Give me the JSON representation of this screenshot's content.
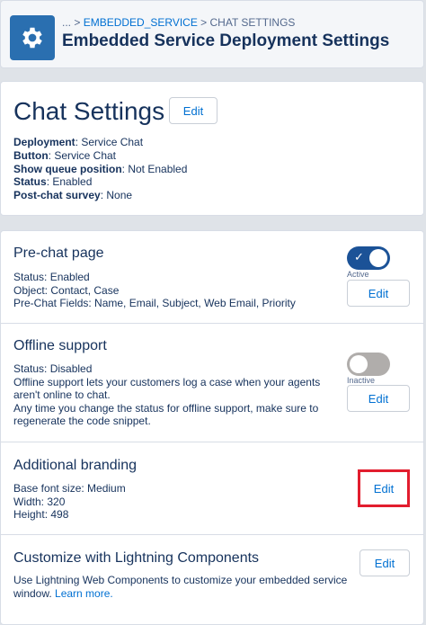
{
  "header": {
    "breadcrumb_prefix": "... > ",
    "breadcrumb_link": "EMBEDDED_SERVICE",
    "breadcrumb_suffix": " > CHAT SETTINGS",
    "title": "Embedded Service Deployment Settings",
    "icon": "gear-icon"
  },
  "chat_settings": {
    "title": "Chat Settings",
    "edit_label": "Edit",
    "details": [
      {
        "label": "Deployment",
        "value": ": Service Chat"
      },
      {
        "label": "Button",
        "value": ": Service Chat"
      },
      {
        "label": "Show queue position",
        "value": ": Not Enabled"
      },
      {
        "label": "Status",
        "value": ": Enabled"
      },
      {
        "label": "Post-chat survey",
        "value": ": None"
      }
    ]
  },
  "prechat": {
    "title": "Pre-chat page",
    "lines": [
      "Status: Enabled",
      "Object: Contact, Case",
      "Pre-Chat Fields: Name, Email, Subject, Web Email, Priority"
    ],
    "toggle_label": "Active",
    "toggle_on": true,
    "edit_label": "Edit"
  },
  "offline": {
    "title": "Offline support",
    "lines": [
      "Status: Disabled",
      "Offline support lets your customers log a case when your agents",
      "aren't online to chat.",
      "Any time you change the status for offline support, make sure to",
      "regenerate the code snippet."
    ],
    "toggle_label": "Inactive",
    "toggle_on": false,
    "edit_label": "Edit"
  },
  "branding": {
    "title": "Additional branding",
    "lines": [
      "Base font size: Medium",
      "Width: 320",
      "Height: 498"
    ],
    "edit_label": "Edit"
  },
  "lightning": {
    "title": "Customize with Lightning Components",
    "line1": "Use Lightning Web Components to customize your embedded service",
    "line2_prefix": "window. ",
    "learn_more": "Learn more.",
    "edit_label": "Edit"
  },
  "colors": {
    "accent": "#0070d2",
    "toggle_on": "#1b5297",
    "toggle_off": "#b0adab",
    "highlight": "#e21d2e",
    "icon_bg": "#2a6fb0"
  }
}
